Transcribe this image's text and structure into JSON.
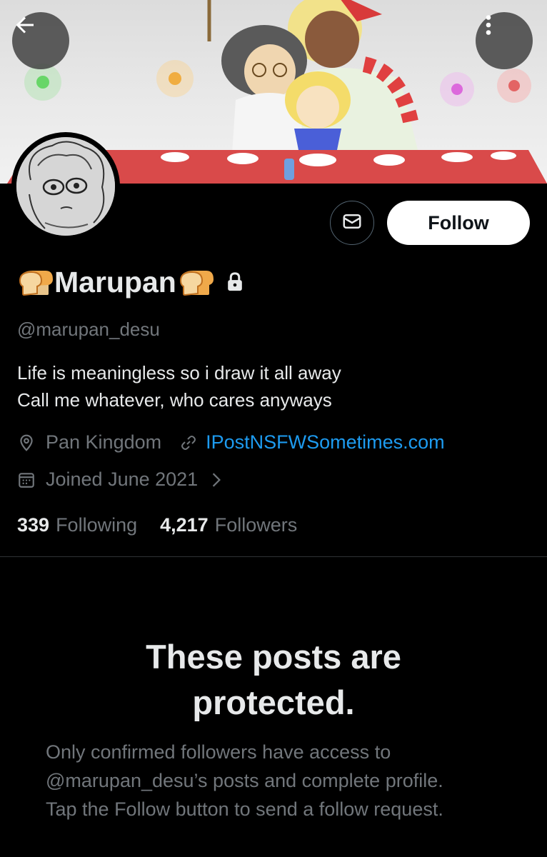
{
  "colors": {
    "background": "#000000",
    "primary_text": "#e7e9ea",
    "secondary_text": "#71767b",
    "link": "#1d9bf0",
    "follow_button_bg": "#ffffff",
    "divider": "#2f3336"
  },
  "header": {
    "back_icon": "arrow-left-icon",
    "more_icon": "more-vertical-icon"
  },
  "profile": {
    "display_name": "Marupan",
    "name_emoji": "bread-icon",
    "protected_icon": "lock-icon",
    "handle": "@marupan_desu",
    "bio": [
      "Life is meaningless so i draw it all away",
      "Call me whatever, who cares anyways"
    ],
    "location": "Pan Kingdom",
    "website": "IPostNSFWSometimes.com",
    "joined": "Joined June 2021",
    "following_count": "339",
    "following_label": "Following",
    "followers_count": "4,217",
    "followers_label": "Followers"
  },
  "actions": {
    "message_icon": "envelope-icon",
    "follow_label": "Follow"
  },
  "protected": {
    "title_line1": "These posts are",
    "title_line2": "protected.",
    "desc_lines": [
      "Only confirmed followers have access to",
      "@marupan_desu’s posts and complete profile.",
      "Tap the Follow button to send a follow request."
    ]
  }
}
